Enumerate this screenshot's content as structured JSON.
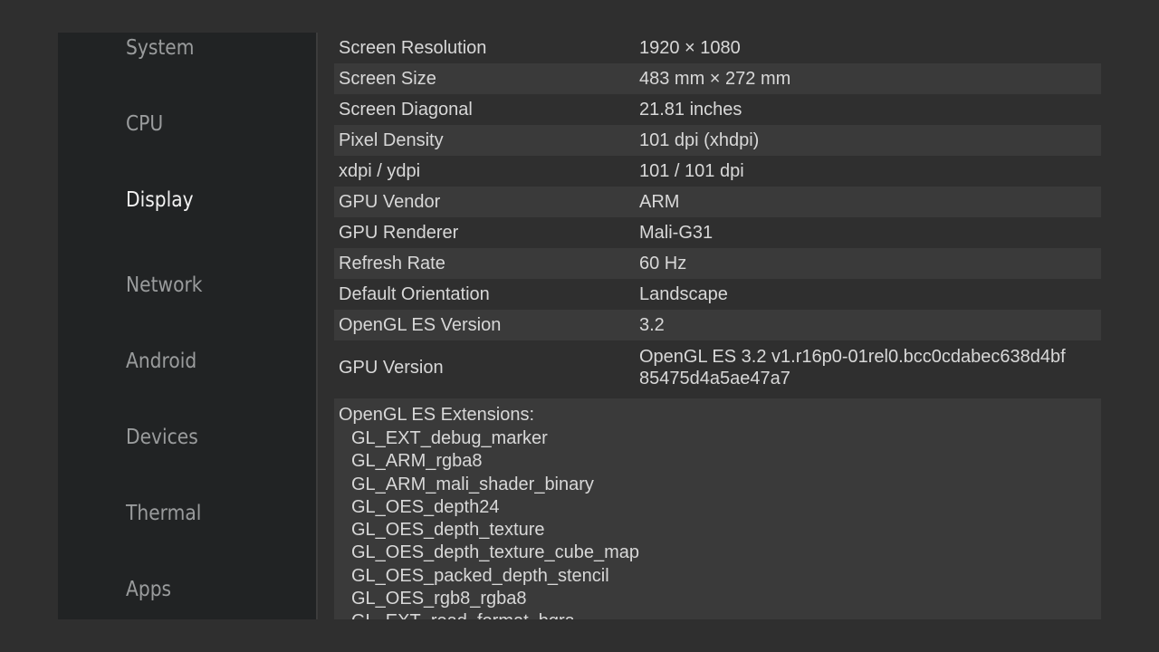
{
  "sidebar": {
    "items": [
      {
        "label": "System",
        "active": false
      },
      {
        "label": "CPU",
        "active": false
      },
      {
        "label": "Display",
        "active": true
      },
      {
        "label": "Network",
        "active": false
      },
      {
        "label": "Android",
        "active": false
      },
      {
        "label": "Devices",
        "active": false
      },
      {
        "label": "Thermal",
        "active": false
      },
      {
        "label": "Apps",
        "active": false
      }
    ]
  },
  "display_info": {
    "rows": [
      {
        "label": "Screen Resolution",
        "value": "1920 × 1080"
      },
      {
        "label": "Screen Size",
        "value": "483 mm × 272 mm"
      },
      {
        "label": "Screen Diagonal",
        "value": "21.81 inches"
      },
      {
        "label": "Pixel Density",
        "value": "101 dpi (xhdpi)"
      },
      {
        "label": "xdpi / ydpi",
        "value": "101 / 101 dpi"
      },
      {
        "label": "GPU Vendor",
        "value": "ARM"
      },
      {
        "label": "GPU Renderer",
        "value": "Mali-G31"
      },
      {
        "label": "Refresh Rate",
        "value": "60 Hz"
      },
      {
        "label": "Default Orientation",
        "value": "Landscape"
      },
      {
        "label": "OpenGL ES Version",
        "value": "3.2"
      }
    ],
    "gpu_version": {
      "label": "GPU Version",
      "value_line1": "OpenGL ES 3.2 v1.r16p0-01rel0.bcc0cdabec638d4bf",
      "value_line2": "85475d4a5ae47a7"
    },
    "extensions": {
      "title": "OpenGL ES Extensions:",
      "items": [
        "GL_EXT_debug_marker",
        "GL_ARM_rgba8",
        "GL_ARM_mali_shader_binary",
        "GL_OES_depth24",
        "GL_OES_depth_texture",
        "GL_OES_depth_texture_cube_map",
        "GL_OES_packed_depth_stencil",
        "GL_OES_rgb8_rgba8",
        "GL_EXT_read_format_bgra"
      ]
    }
  },
  "colors": {
    "background": "#2f2f2f",
    "sidebar": "#212324",
    "row_alt": "#3a3a3a",
    "active_text": "#f2f2f2",
    "inactive_text": "#9a9c9d"
  }
}
